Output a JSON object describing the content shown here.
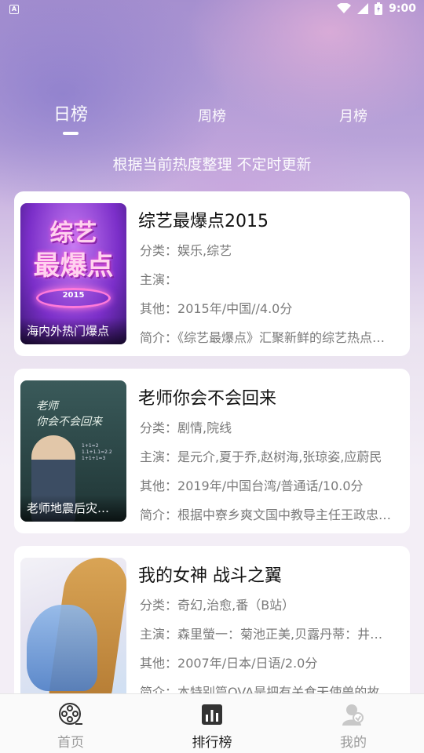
{
  "status_bar": {
    "time": "9:00",
    "app_icon": "A"
  },
  "tabs": [
    {
      "label": "日榜",
      "active": true
    },
    {
      "label": "周榜",
      "active": false
    },
    {
      "label": "月榜",
      "active": false
    }
  ],
  "subtitle": "根据当前热度整理 不定时更新",
  "items": [
    {
      "title": "综艺最爆点2015",
      "poster_caption": "海内外热门爆点",
      "poster_art_text": "综艺\n最爆点",
      "poster_art_year": "2015",
      "category_label": "分类：",
      "category": "娱乐,综艺",
      "cast_label": "主演：",
      "cast": "",
      "other_label": "其他：",
      "other": "2015年/中国//4.0分",
      "intro_label": "简介：",
      "intro": "《综艺最爆点》汇聚新鲜的综艺热点资讯"
    },
    {
      "title": "老师你会不会回来",
      "poster_caption": "老师地震后灾区支教",
      "poster_art_text": "老师\n你会不会回来",
      "category_label": "分类：",
      "category": "剧情,院线",
      "cast_label": "主演：",
      "cast": "是元介,夏于乔,赵树海,张琼姿,应蔚民",
      "other_label": "其他：",
      "other": "2019年/中国台湾/普通话/10.0分",
      "intro_label": "简介：",
      "intro": "根据中寮乡爽文国中教导主任王政忠的故事改编"
    },
    {
      "title": "我的女神 战斗之翼",
      "poster_caption": "",
      "category_label": "分类：",
      "category": "奇幻,治愈,番（B站）",
      "cast_label": "主演：",
      "cast": "森里螢一：菊池正美,贝露丹蒂：井上喜久子",
      "other_label": "其他：",
      "other": "2007年/日本/日语/2.0分",
      "intro_label": "简介：",
      "intro": "本特别篇OVA是把有关食天使兽的故事制作成动画"
    }
  ],
  "bottom_nav": [
    {
      "label": "首页",
      "icon": "film-reel-icon",
      "active": false
    },
    {
      "label": "排行榜",
      "icon": "ranking-chart-icon",
      "active": true
    },
    {
      "label": "我的",
      "icon": "profile-icon",
      "active": false
    }
  ],
  "colors": {
    "accent_text": "#222222",
    "inactive_text": "#9a9a9a",
    "card_bg": "#ffffff"
  }
}
